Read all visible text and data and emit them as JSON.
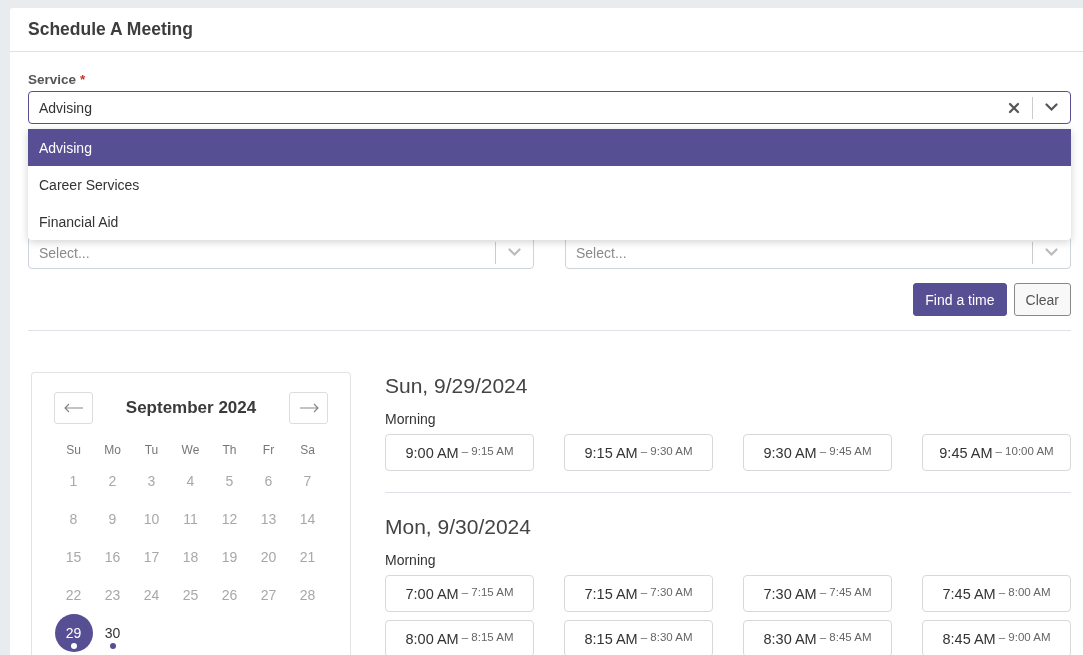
{
  "title": "Schedule A Meeting",
  "service": {
    "label": "Service",
    "required": true,
    "required_mark": "*",
    "value": "Advising",
    "expanded": true,
    "options": [
      {
        "label": "Advising",
        "selected": true
      },
      {
        "label": "Career Services",
        "selected": false
      },
      {
        "label": "Financial Aid",
        "selected": false
      }
    ]
  },
  "filters": [
    {
      "placeholder": "Select..."
    },
    {
      "placeholder": "Select..."
    }
  ],
  "buttons": [
    {
      "label": "Find a time",
      "kind": "primary"
    },
    {
      "label": "Clear",
      "kind": "secondary"
    }
  ],
  "calendar": {
    "month": "September 2024",
    "weekdays": [
      "Su",
      "Mo",
      "Tu",
      "We",
      "Th",
      "Fr",
      "Sa"
    ],
    "days": [
      {
        "label": "1",
        "disabled": true,
        "selected": false,
        "available": false
      },
      {
        "label": "2",
        "disabled": true,
        "selected": false,
        "available": false
      },
      {
        "label": "3",
        "disabled": true,
        "selected": false,
        "available": false
      },
      {
        "label": "4",
        "disabled": true,
        "selected": false,
        "available": false
      },
      {
        "label": "5",
        "disabled": true,
        "selected": false,
        "available": false
      },
      {
        "label": "6",
        "disabled": true,
        "selected": false,
        "available": false
      },
      {
        "label": "7",
        "disabled": true,
        "selected": false,
        "available": false
      },
      {
        "label": "8",
        "disabled": true,
        "selected": false,
        "available": false
      },
      {
        "label": "9",
        "disabled": true,
        "selected": false,
        "available": false
      },
      {
        "label": "10",
        "disabled": true,
        "selected": false,
        "available": false
      },
      {
        "label": "11",
        "disabled": true,
        "selected": false,
        "available": false
      },
      {
        "label": "12",
        "disabled": true,
        "selected": false,
        "available": false
      },
      {
        "label": "13",
        "disabled": true,
        "selected": false,
        "available": false
      },
      {
        "label": "14",
        "disabled": true,
        "selected": false,
        "available": false
      },
      {
        "label": "15",
        "disabled": true,
        "selected": false,
        "available": false
      },
      {
        "label": "16",
        "disabled": true,
        "selected": false,
        "available": false
      },
      {
        "label": "17",
        "disabled": true,
        "selected": false,
        "available": false
      },
      {
        "label": "18",
        "disabled": true,
        "selected": false,
        "available": false
      },
      {
        "label": "19",
        "disabled": true,
        "selected": false,
        "available": false
      },
      {
        "label": "20",
        "disabled": true,
        "selected": false,
        "available": false
      },
      {
        "label": "21",
        "disabled": true,
        "selected": false,
        "available": false
      },
      {
        "label": "22",
        "disabled": true,
        "selected": false,
        "available": false
      },
      {
        "label": "23",
        "disabled": true,
        "selected": false,
        "available": false
      },
      {
        "label": "24",
        "disabled": true,
        "selected": false,
        "available": false
      },
      {
        "label": "25",
        "disabled": true,
        "selected": false,
        "available": false
      },
      {
        "label": "26",
        "disabled": true,
        "selected": false,
        "available": false
      },
      {
        "label": "27",
        "disabled": true,
        "selected": false,
        "available": false
      },
      {
        "label": "28",
        "disabled": true,
        "selected": false,
        "available": false
      },
      {
        "label": "29",
        "disabled": false,
        "selected": true,
        "available": true
      },
      {
        "label": "30",
        "disabled": false,
        "selected": false,
        "available": true
      }
    ]
  },
  "schedule": [
    {
      "date": "Sun, 9/29/2024",
      "period": "Morning",
      "slots": [
        {
          "start": "9:00 AM",
          "end": "– 9:15 AM"
        },
        {
          "start": "9:15 AM",
          "end": "– 9:30 AM"
        },
        {
          "start": "9:30 AM",
          "end": "– 9:45 AM"
        },
        {
          "start": "9:45 AM",
          "end": "– 10:00 AM"
        }
      ]
    },
    {
      "date": "Mon, 9/30/2024",
      "period": "Morning",
      "slots": [
        {
          "start": "7:00 AM",
          "end": "– 7:15 AM"
        },
        {
          "start": "7:15 AM",
          "end": "– 7:30 AM"
        },
        {
          "start": "7:30 AM",
          "end": "– 7:45 AM"
        },
        {
          "start": "7:45 AM",
          "end": "– 8:00 AM"
        },
        {
          "start": "8:00 AM",
          "end": "– 8:15 AM"
        },
        {
          "start": "8:15 AM",
          "end": "– 8:30 AM"
        },
        {
          "start": "8:30 AM",
          "end": "– 8:45 AM"
        },
        {
          "start": "8:45 AM",
          "end": "– 9:00 AM"
        }
      ]
    }
  ]
}
